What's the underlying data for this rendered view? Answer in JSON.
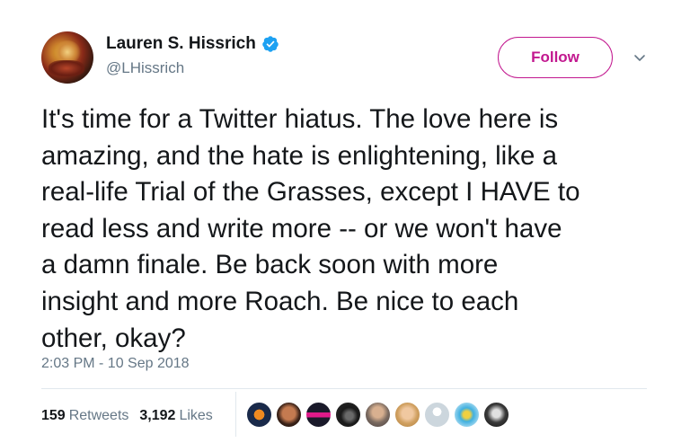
{
  "author": {
    "display_name": "Lauren S. Hissrich",
    "handle": "@LHissrich",
    "verified": true,
    "avatar_icon": "profile-avatar"
  },
  "follow_button": {
    "label": "Follow"
  },
  "menu_icon": "chevron-down-icon",
  "tweet": {
    "text": "It's time for a Twitter hiatus. The love here is\namazing, and the hate is enlightening, like a\nreal-life Trial of the Grasses, except I HAVE to\nread less and write more -- or we won't have\na damn finale. Be back soon with more\ninsight and more Roach. Be nice to each\nother, okay?",
    "timestamp": "2:03 PM - 10 Sep 2018"
  },
  "stats": {
    "retweets_count": "159",
    "retweets_label": "Retweets",
    "likes_count": "3,192",
    "likes_label": "Likes"
  },
  "likers": [
    {
      "icon": "liker-avatar-1"
    },
    {
      "icon": "liker-avatar-2"
    },
    {
      "icon": "liker-avatar-3"
    },
    {
      "icon": "liker-avatar-4"
    },
    {
      "icon": "liker-avatar-5"
    },
    {
      "icon": "liker-avatar-6"
    },
    {
      "icon": "liker-avatar-7"
    },
    {
      "icon": "liker-avatar-8"
    },
    {
      "icon": "liker-avatar-9"
    }
  ],
  "colors": {
    "follow_accent": "#c2188f",
    "verified_blue": "#1da1f2",
    "secondary_text": "#657786"
  }
}
